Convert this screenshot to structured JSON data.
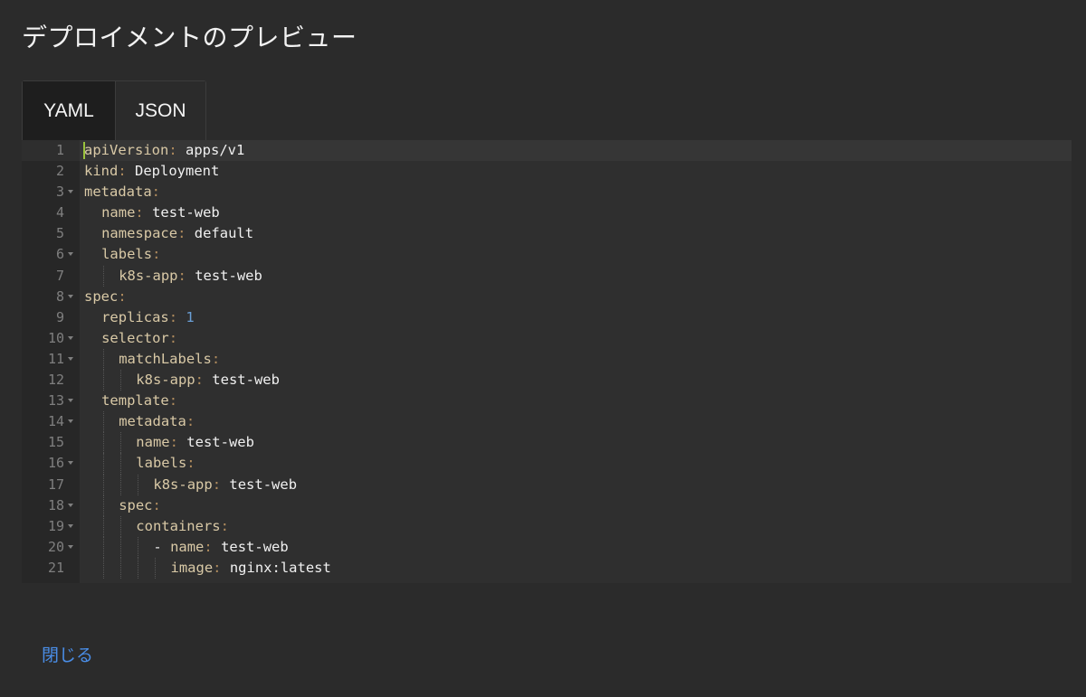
{
  "dialog": {
    "title": "デプロイメントのプレビュー",
    "close_label": "閉じる"
  },
  "tabs": [
    {
      "label": "YAML",
      "active": true
    },
    {
      "label": "JSON",
      "active": false
    }
  ],
  "editor": {
    "lines": [
      {
        "n": "1",
        "indent": 0,
        "key": "apiVersion",
        "value": "apps/v1",
        "fold": false
      },
      {
        "n": "2",
        "indent": 0,
        "key": "kind",
        "value": "Deployment",
        "fold": false
      },
      {
        "n": "3",
        "indent": 0,
        "key": "metadata",
        "value": "",
        "fold": true
      },
      {
        "n": "4",
        "indent": 1,
        "key": "name",
        "value": "test-web",
        "fold": false
      },
      {
        "n": "5",
        "indent": 1,
        "key": "namespace",
        "value": "default",
        "fold": false
      },
      {
        "n": "6",
        "indent": 1,
        "key": "labels",
        "value": "",
        "fold": true
      },
      {
        "n": "7",
        "indent": 2,
        "key": "k8s-app",
        "value": "test-web",
        "fold": false
      },
      {
        "n": "8",
        "indent": 0,
        "key": "spec",
        "value": "",
        "fold": true
      },
      {
        "n": "9",
        "indent": 1,
        "key": "replicas",
        "value": "1",
        "numeric": true,
        "fold": false
      },
      {
        "n": "10",
        "indent": 1,
        "key": "selector",
        "value": "",
        "fold": true
      },
      {
        "n": "11",
        "indent": 2,
        "key": "matchLabels",
        "value": "",
        "fold": true
      },
      {
        "n": "12",
        "indent": 3,
        "key": "k8s-app",
        "value": "test-web",
        "fold": false
      },
      {
        "n": "13",
        "indent": 1,
        "key": "template",
        "value": "",
        "fold": true
      },
      {
        "n": "14",
        "indent": 2,
        "key": "metadata",
        "value": "",
        "fold": true
      },
      {
        "n": "15",
        "indent": 3,
        "key": "name",
        "value": "test-web",
        "fold": false
      },
      {
        "n": "16",
        "indent": 3,
        "key": "labels",
        "value": "",
        "fold": true
      },
      {
        "n": "17",
        "indent": 4,
        "key": "k8s-app",
        "value": "test-web",
        "fold": false
      },
      {
        "n": "18",
        "indent": 2,
        "key": "spec",
        "value": "",
        "fold": true
      },
      {
        "n": "19",
        "indent": 3,
        "key": "containers",
        "value": "",
        "fold": true
      },
      {
        "n": "20",
        "indent": 4,
        "key": "name",
        "value": "test-web",
        "dash": true,
        "fold": true
      },
      {
        "n": "21",
        "indent": 5,
        "key": "image",
        "value": "nginx:latest",
        "fold": false
      }
    ]
  }
}
